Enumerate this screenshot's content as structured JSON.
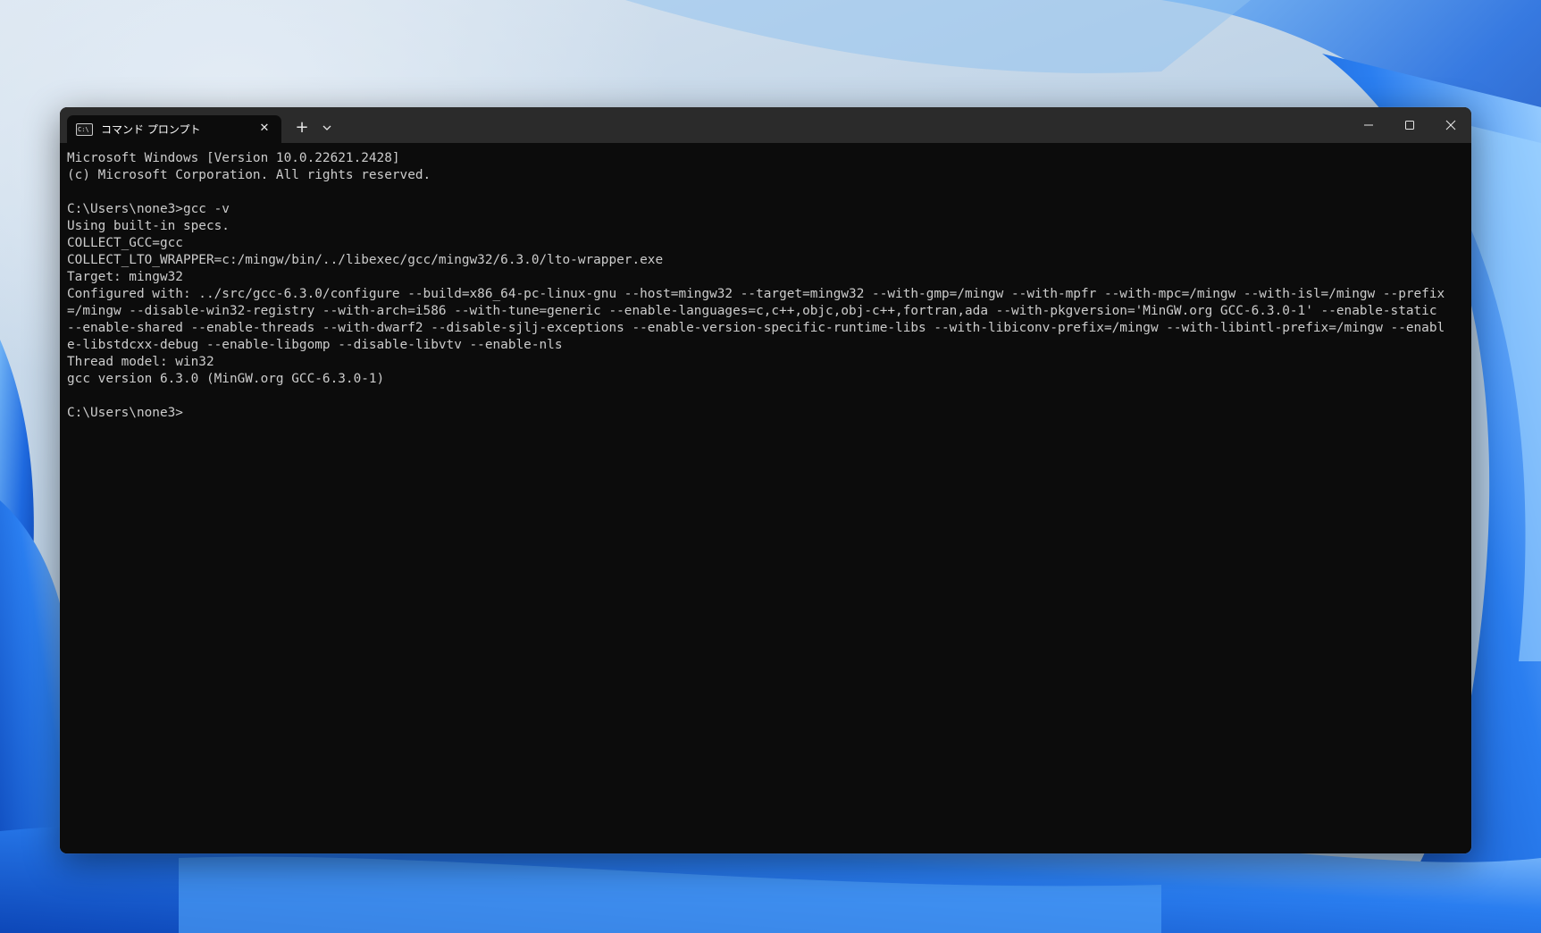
{
  "window": {
    "tab_title": "コマンド プロンプト",
    "tab_icon_text": "C:\\",
    "new_tab_label": "+",
    "close_tab_label": "✕"
  },
  "terminal": {
    "lines": [
      "Microsoft Windows [Version 10.0.22621.2428]",
      "(c) Microsoft Corporation. All rights reserved.",
      "",
      "C:\\Users\\none3>gcc -v",
      "Using built-in specs.",
      "COLLECT_GCC=gcc",
      "COLLECT_LTO_WRAPPER=c:/mingw/bin/../libexec/gcc/mingw32/6.3.0/lto-wrapper.exe",
      "Target: mingw32",
      "Configured with: ../src/gcc-6.3.0/configure --build=x86_64-pc-linux-gnu --host=mingw32 --target=mingw32 --with-gmp=/mingw --with-mpfr --with-mpc=/mingw --with-isl=/mingw --prefix=/mingw --disable-win32-registry --with-arch=i586 --with-tune=generic --enable-languages=c,c++,objc,obj-c++,fortran,ada --with-pkgversion='MinGW.org GCC-6.3.0-1' --enable-static --enable-shared --enable-threads --with-dwarf2 --disable-sjlj-exceptions --enable-version-specific-runtime-libs --with-libiconv-prefix=/mingw --with-libintl-prefix=/mingw --enable-libstdcxx-debug --enable-libgomp --disable-libvtv --enable-nls",
      "Thread model: win32",
      "gcc version 6.3.0 (MinGW.org GCC-6.3.0-1)",
      "",
      "C:\\Users\\none3>"
    ]
  },
  "colors": {
    "terminal_bg": "#0c0c0c",
    "terminal_fg": "#cccccc",
    "titlebar_bg": "#2b2b2b",
    "wallpaper_accent": "#1a5fd6"
  }
}
